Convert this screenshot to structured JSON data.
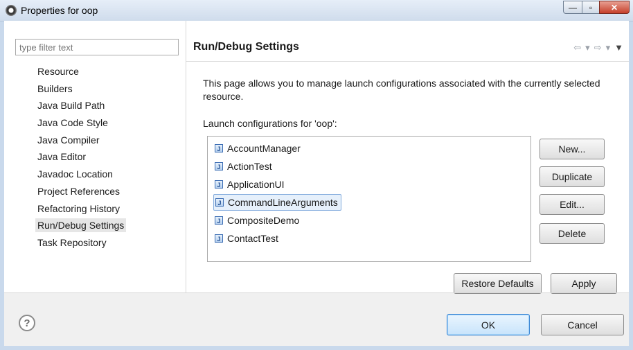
{
  "window": {
    "title": "Properties for oop",
    "controls": {
      "minimize": "—",
      "maximize": "▫",
      "close": "✕"
    }
  },
  "sidebar": {
    "filter_placeholder": "type filter text",
    "items": [
      {
        "label": "Resource"
      },
      {
        "label": "Builders"
      },
      {
        "label": "Java Build Path"
      },
      {
        "label": "Java Code Style"
      },
      {
        "label": "Java Compiler"
      },
      {
        "label": "Java Editor"
      },
      {
        "label": "Javadoc Location"
      },
      {
        "label": "Project References"
      },
      {
        "label": "Refactoring History"
      },
      {
        "label": "Run/Debug Settings",
        "selected": true
      },
      {
        "label": "Task Repository"
      }
    ]
  },
  "page": {
    "title": "Run/Debug Settings",
    "description": "This page allows you to manage launch configurations associated with the currently selected resource.",
    "list_label": "Launch configurations for 'oop':",
    "configurations": [
      {
        "label": "AccountManager"
      },
      {
        "label": "ActionTest"
      },
      {
        "label": "ApplicationUI"
      },
      {
        "label": "CommandLineArguments",
        "selected": true
      },
      {
        "label": "CompositeDemo"
      },
      {
        "label": "ContactTest"
      }
    ],
    "buttons": {
      "new": "New...",
      "duplicate": "Duplicate",
      "edit": "Edit...",
      "delete": "Delete",
      "restore_defaults": "Restore Defaults",
      "apply": "Apply"
    }
  },
  "footer": {
    "ok": "OK",
    "cancel": "Cancel"
  },
  "icons": {
    "nav_back": "back-arrow-icon",
    "nav_forward": "forward-arrow-icon",
    "view_menu": "view-menu-icon",
    "help": "help-icon",
    "config": "java-launch-config-icon"
  },
  "colors": {
    "selection_border": "#84acdd",
    "default_button": "#3a86d4"
  }
}
